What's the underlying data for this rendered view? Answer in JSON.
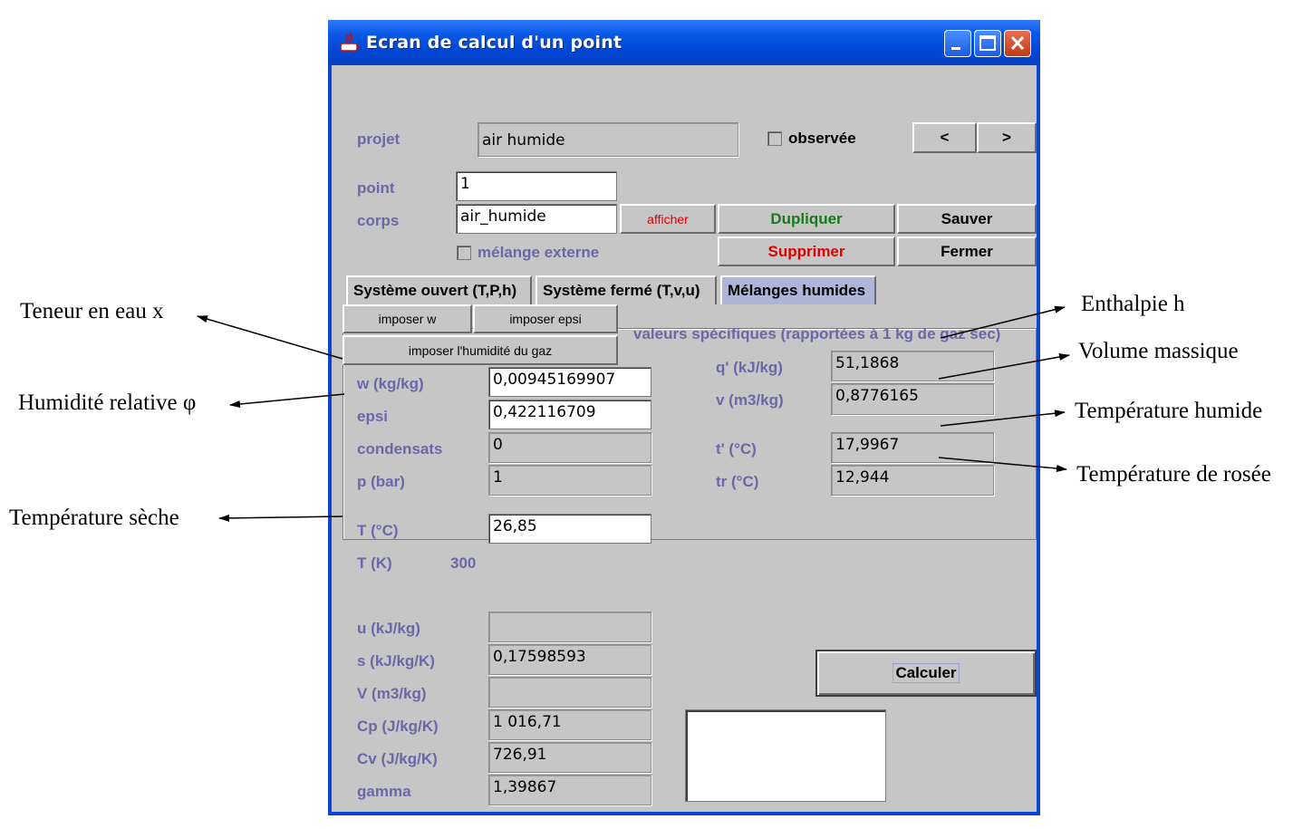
{
  "window": {
    "title": "Ecran de calcul d'un point"
  },
  "header": {
    "projet_label": "projet",
    "projet_value": "air humide",
    "observee_label": "observée",
    "prev_label": "<",
    "next_label": ">",
    "point_label": "point",
    "point_value": "1",
    "corps_label": "corps",
    "corps_value": "air_humide",
    "afficher_label": "afficher",
    "dupliquer_label": "Dupliquer",
    "sauver_label": "Sauver",
    "melange_label": "mélange externe",
    "supprimer_label": "Supprimer",
    "fermer_label": "Fermer"
  },
  "tabs": [
    {
      "label": "Système ouvert (T,P,h)"
    },
    {
      "label": "Système fermé (T,v,u)"
    },
    {
      "label": "Mélanges humides"
    }
  ],
  "humid": {
    "imposer_w": "imposer w",
    "imposer_epsi": "imposer epsi",
    "imposer_hum": "imposer l'humidité du gaz",
    "specific_title": "valeurs spécifiques (rapportées à 1 kg de gaz sec)",
    "w_label": "w (kg/kg)",
    "w_value": "0,00945169907",
    "epsi_label": "epsi",
    "epsi_value": "0,422116709",
    "cond_label": "condensats",
    "cond_value": "0",
    "p_label": "p (bar)",
    "p_value": "1",
    "q_label": "q' (kJ/kg)",
    "q_value": "51,1868",
    "v_label": "v (m3/kg)",
    "v_value": "0,8776165",
    "th_label": "t' (°C)",
    "th_value": "17,9967",
    "tr_label": "tr (°C)",
    "tr_value": "12,944"
  },
  "props": {
    "T_label": "T (°C)",
    "T_value": "26,85",
    "TK_label": "T (K)",
    "TK_value": "300",
    "u_label": "u (kJ/kg)",
    "u_value": "",
    "s_label": "s (kJ/kg/K)",
    "s_value": "0,17598593",
    "V_label": "V (m3/kg)",
    "V_value": "",
    "cp_label": "Cp (J/kg/K)",
    "cp_value": "1 016,71",
    "cv_label": "Cv (J/kg/K)",
    "cv_value": "726,91",
    "gamma_label": "gamma",
    "gamma_value": "1,39867",
    "calculer_label": "Calculer"
  },
  "annotations": {
    "teneur": "Teneur en eau x",
    "humidite": "Humidité relative φ",
    "temp_seche": "Température  sèche",
    "enthalpie": "Enthalpie h",
    "volume": "Volume  massique",
    "temp_humide": "Température  humide",
    "temp_rosee": "Température  de rosée"
  },
  "colors": {
    "label": "#6a68a8",
    "dupliquer": "#1a7a1a",
    "supprimer": "#e00000",
    "afficher": "#e00000",
    "titlebar": "#0a5ae6"
  }
}
